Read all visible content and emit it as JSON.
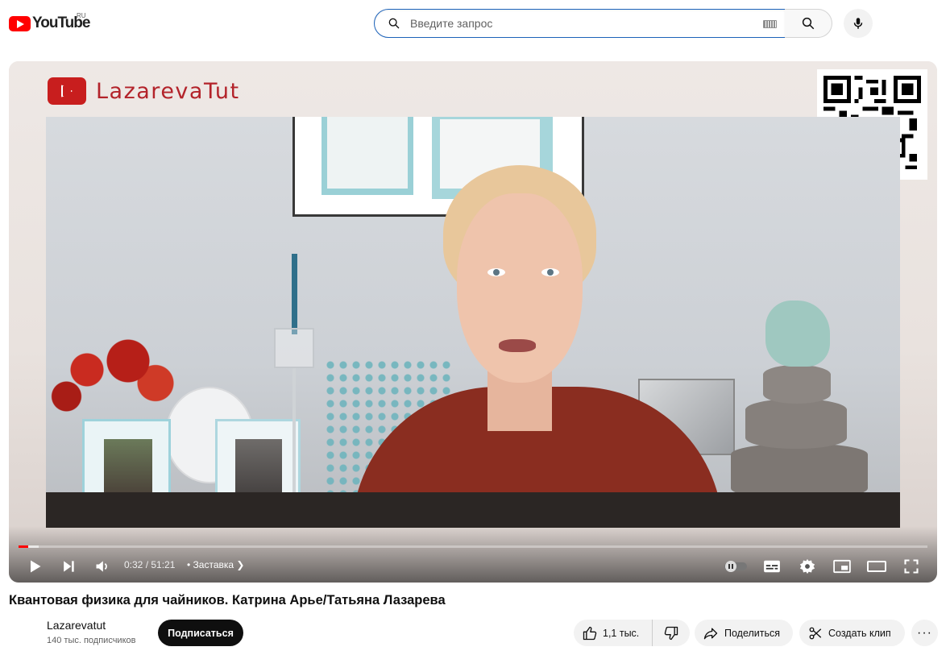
{
  "masthead": {
    "logo_text": "YouTube",
    "country_code": "RU",
    "search": {
      "placeholder": "Введите запрос",
      "value": ""
    }
  },
  "player": {
    "brand_name": "LazarevaTut",
    "time": "0:32 / 51:21",
    "chapter": "• Заставка",
    "progress_played_fraction": 0.0104,
    "progress_loaded_fraction": 0.022
  },
  "video": {
    "title": "Квантовая физика для чайников. Катрина Арье/Татьяна Лазарева",
    "channel_name": "Lazarevatut",
    "subscribers": "140 тыс. подписчиков",
    "subscribe_label": "Подписаться",
    "likes": "1,1 тыс.",
    "share_label": "Поделиться",
    "clip_label": "Создать клип",
    "more_label": "···"
  },
  "colors": {
    "accent": "#ff0000",
    "brand_red": "#b3232a",
    "search_border": "#1c62b9"
  },
  "icons": [
    "search-icon",
    "keyboard-icon",
    "mic-icon",
    "play-icon",
    "next-icon",
    "volume-icon",
    "autoplay-toggle-icon",
    "subtitles-icon",
    "settings-icon",
    "miniplayer-icon",
    "theater-icon",
    "fullscreen-icon",
    "like-icon",
    "dislike-icon",
    "share-icon",
    "clip-icon"
  ]
}
